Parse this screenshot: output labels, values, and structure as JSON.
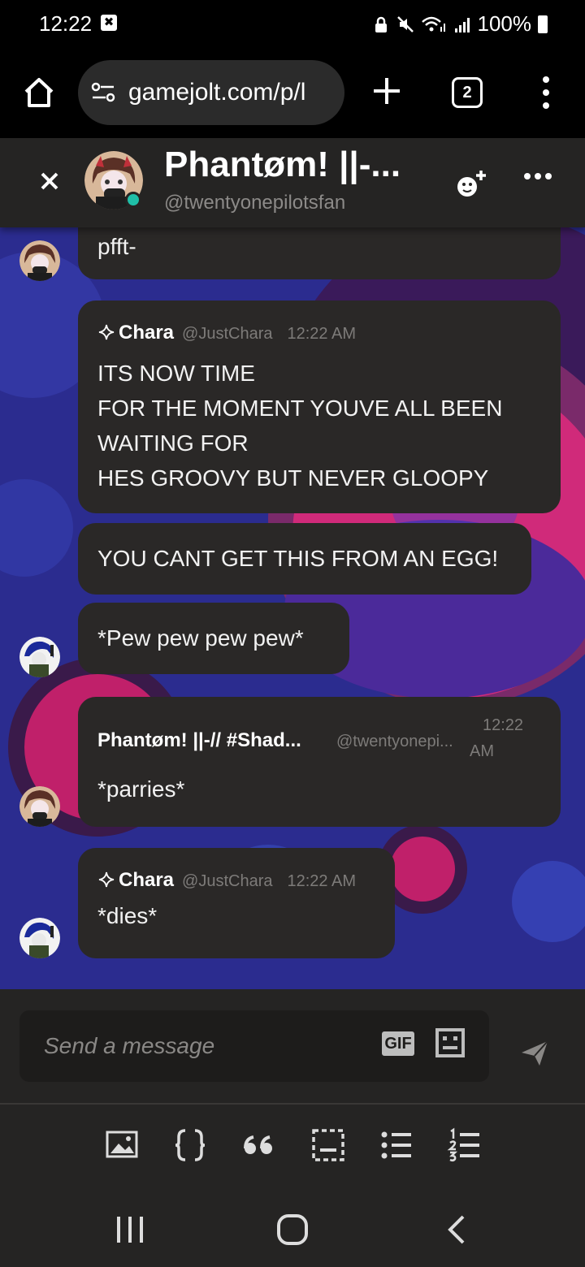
{
  "status_bar": {
    "time": "12:22",
    "notif_glyph": "✖",
    "battery": "100%"
  },
  "browser": {
    "url": "gamejolt.com/p/l",
    "tab_count": "2"
  },
  "chat_header": {
    "name": "Phantøm! ||-...",
    "handle": "@twentyonepilotsfan"
  },
  "messages": [
    {
      "text": "pfft-"
    },
    {
      "name": "Chara",
      "handle": "@JustChara",
      "time": "12:22 AM",
      "text": "ITS NOW TIME\nFOR THE MOMENT YOUVE ALL BEEN WAITING FOR\nHES GROOVY BUT NEVER GLOOPY"
    },
    {
      "text": "YOU CANT GET THIS FROM AN EGG!"
    },
    {
      "text": "*Pew pew pew pew*"
    },
    {
      "name": "Phantøm! ||-// #Shad...",
      "handle": "@twentyonepi...",
      "time_line1": "12:22",
      "time_line2": "AM",
      "text": "*parries*"
    },
    {
      "name": "Chara",
      "handle": "@JustChara",
      "time": "12:22 AM",
      "text": "*dies*"
    }
  ],
  "composer": {
    "placeholder": "Send a message",
    "gif_label": "GIF"
  },
  "format_toolbar": [
    "image-icon",
    "code-icon",
    "quote-icon",
    "spoiler-icon",
    "bullet-list-icon",
    "numbered-list-icon"
  ],
  "colors": {
    "accent_online": "#1fbfa8",
    "bubble": "#2a2827",
    "header": "#252423",
    "chat_bg": "#2a2f8e"
  }
}
